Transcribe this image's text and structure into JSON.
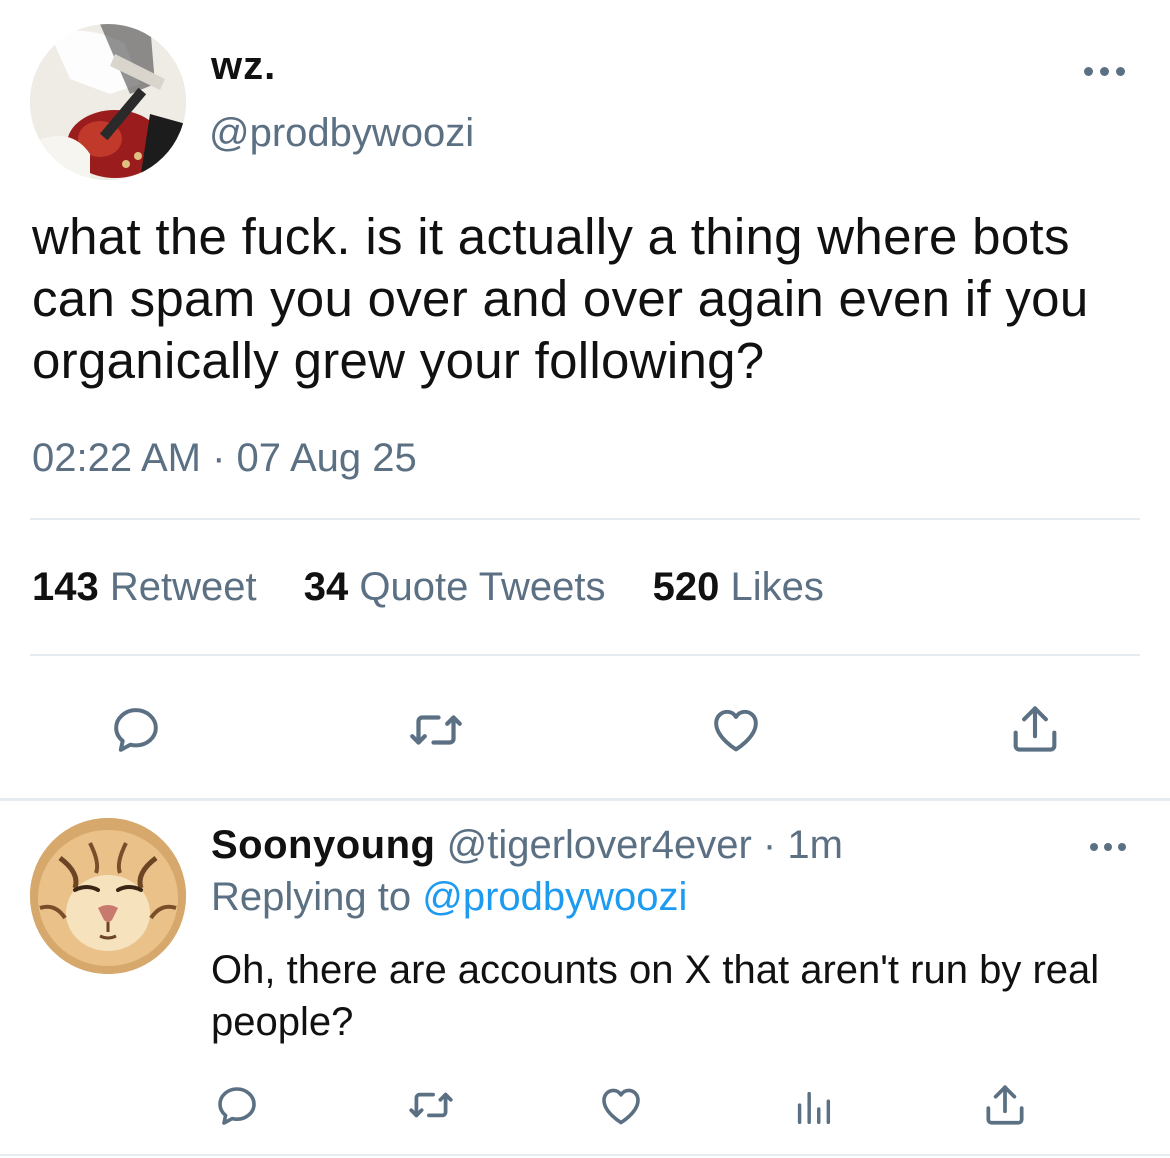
{
  "tweet": {
    "display_name": "wz.",
    "handle": "@prodbywoozi",
    "text": "what the fuck. is it actually a thing where bots can spam you over and over again even if you organically grew your following?",
    "timestamp": "02:22 AM · 07 Aug 25",
    "stats": {
      "retweets_count": "143",
      "retweets_label": "Retweet",
      "quotes_count": "34",
      "quotes_label": "Quote Tweets",
      "likes_count": "520",
      "likes_label": "Likes"
    },
    "actions": [
      "reply-icon",
      "retweet-icon",
      "like-icon",
      "share-icon"
    ]
  },
  "reply": {
    "display_name": "Soonyoung",
    "handle": "@tigerlover4ever",
    "separator": "·",
    "time": "1m",
    "replying_prefix": "Replying to",
    "replying_to": "@prodbywoozi",
    "text": "Oh, there are accounts on X that aren't run by real people?",
    "actions": [
      "reply-icon",
      "retweet-icon",
      "like-icon",
      "analytics-icon",
      "share-icon"
    ]
  },
  "colors": {
    "text_primary": "#111111",
    "text_secondary": "#5b7083",
    "link": "#1d9bf0",
    "divider": "#e6ecf0"
  }
}
